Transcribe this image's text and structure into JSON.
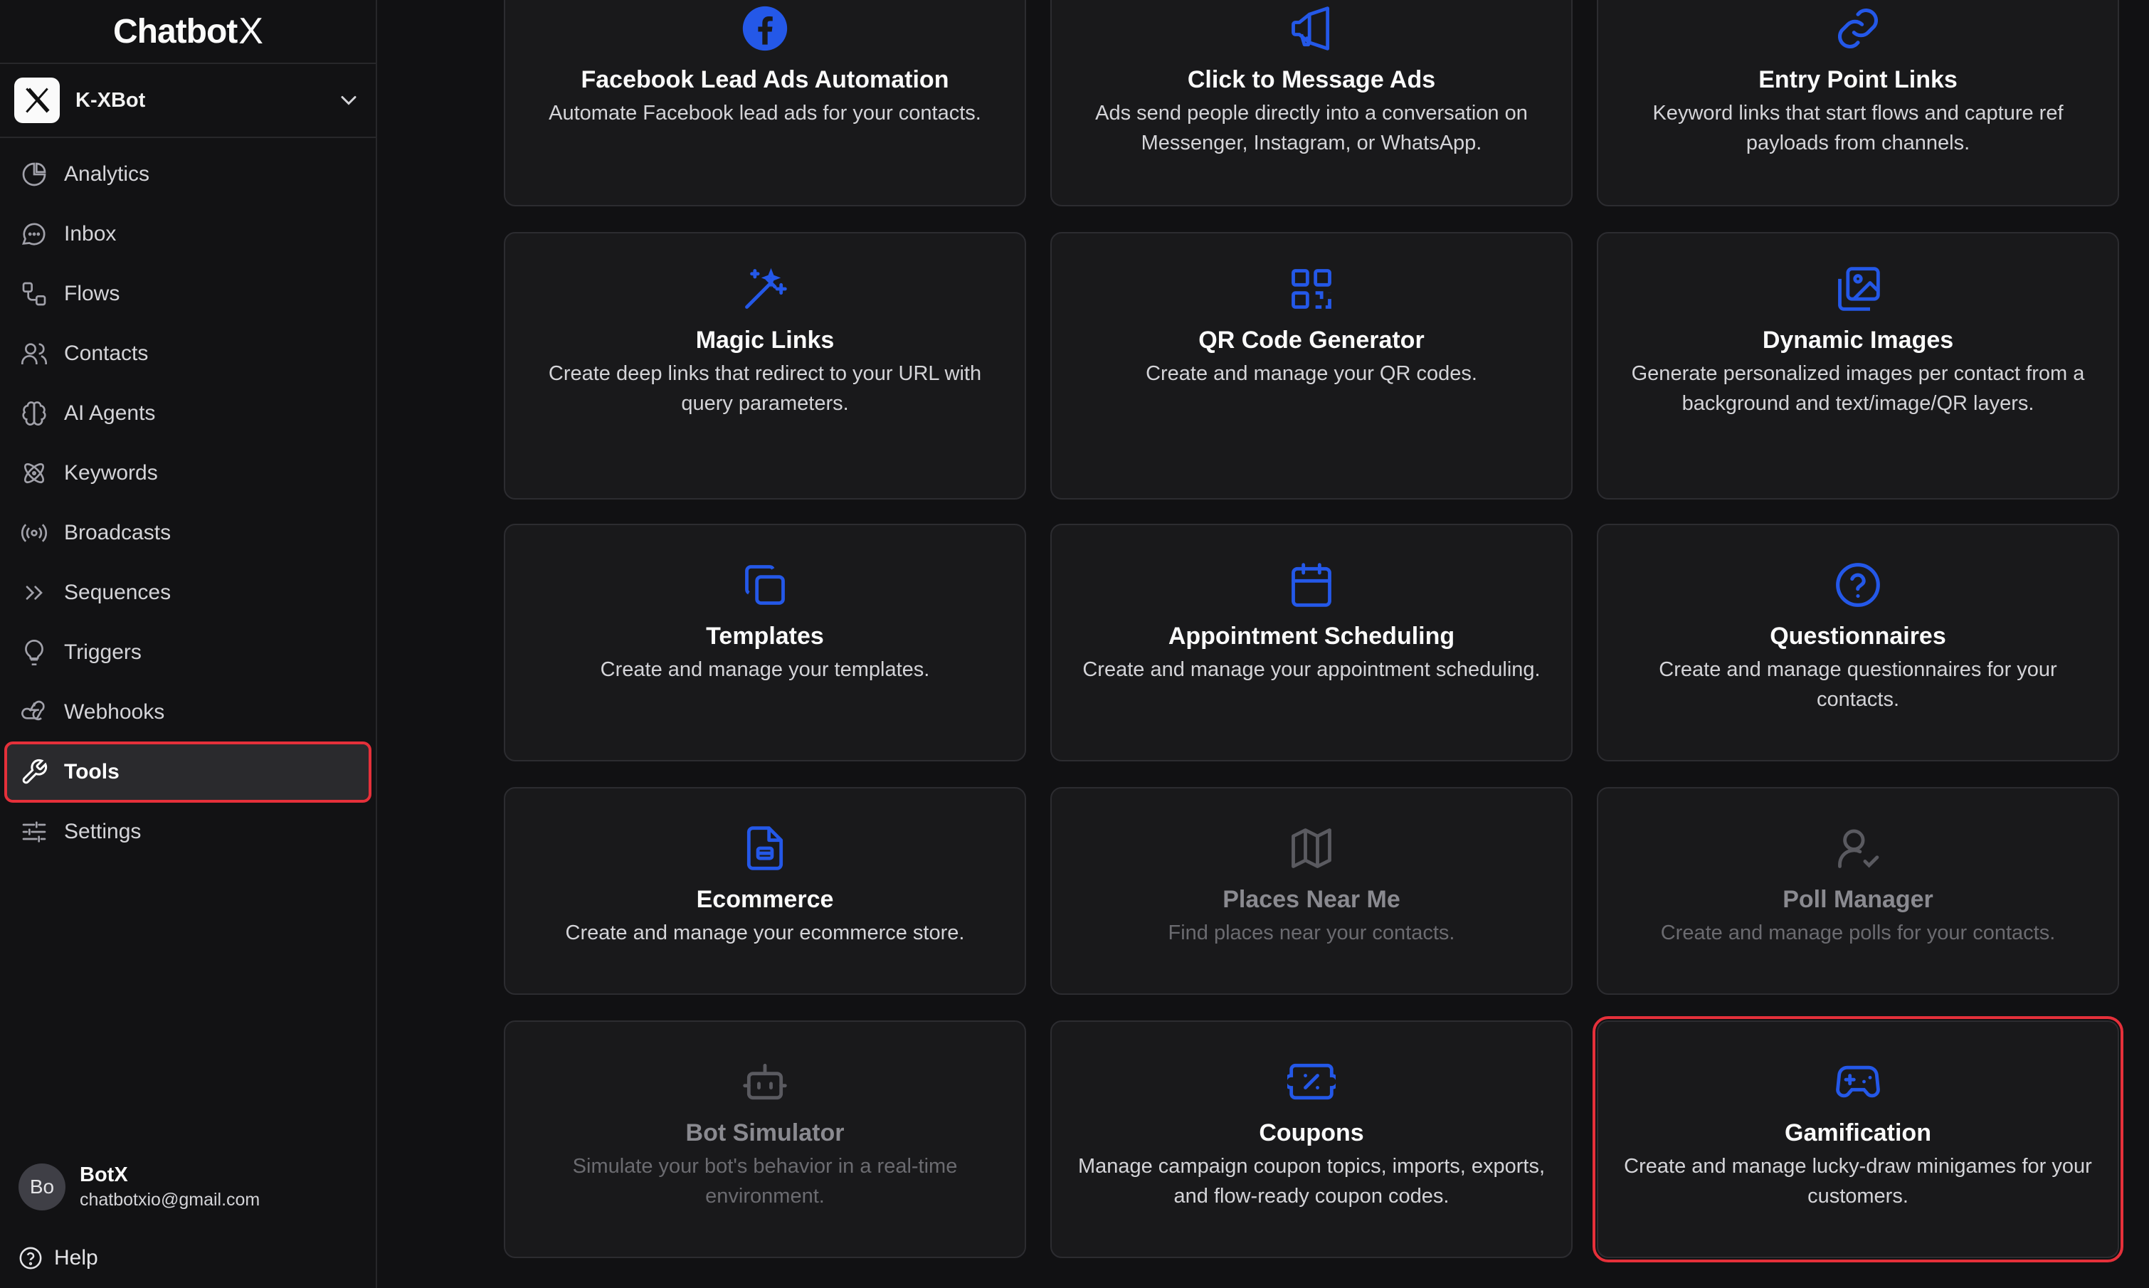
{
  "brand": {
    "name": "Chatbot",
    "mark": "X"
  },
  "bot_selector": {
    "name": "K-XBot"
  },
  "nav": [
    {
      "key": "analytics",
      "label": "Analytics",
      "icon": "pie-chart-icon"
    },
    {
      "key": "inbox",
      "label": "Inbox",
      "icon": "chat-bubble-icon"
    },
    {
      "key": "flows",
      "label": "Flows",
      "icon": "flow-icon"
    },
    {
      "key": "contacts",
      "label": "Contacts",
      "icon": "users-icon"
    },
    {
      "key": "ai-agents",
      "label": "AI Agents",
      "icon": "brain-icon"
    },
    {
      "key": "keywords",
      "label": "Keywords",
      "icon": "atom-icon"
    },
    {
      "key": "broadcasts",
      "label": "Broadcasts",
      "icon": "broadcast-icon"
    },
    {
      "key": "sequences",
      "label": "Sequences",
      "icon": "double-chevron-icon"
    },
    {
      "key": "triggers",
      "label": "Triggers",
      "icon": "lightbulb-icon"
    },
    {
      "key": "webhooks",
      "label": "Webhooks",
      "icon": "webhook-icon"
    },
    {
      "key": "tools",
      "label": "Tools",
      "icon": "wrench-icon",
      "active": true
    },
    {
      "key": "settings",
      "label": "Settings",
      "icon": "sliders-icon"
    }
  ],
  "user": {
    "initials": "Bo",
    "name": "BotX",
    "email": "chatbotxio@gmail.com"
  },
  "help": {
    "label": "Help"
  },
  "tools": [
    {
      "title": "Facebook Lead Ads Automation",
      "desc": "Automate Facebook lead ads for your contacts.",
      "icon": "facebook-icon"
    },
    {
      "title": "Click to Message Ads",
      "desc": "Ads send people directly into a conversation on Messenger, Instagram, or WhatsApp.",
      "icon": "megaphone-icon"
    },
    {
      "title": "Entry Point Links",
      "desc": "Keyword links that start flows and capture ref payloads from channels.",
      "icon": "link-icon"
    },
    {
      "title": "Magic Links",
      "desc": "Create deep links that redirect to your URL with query parameters.",
      "icon": "magic-wand-icon"
    },
    {
      "title": "QR Code Generator",
      "desc": "Create and manage your QR codes.",
      "icon": "qr-code-icon"
    },
    {
      "title": "Dynamic Images",
      "desc": "Generate personalized images per contact from a background and text/image/QR layers.",
      "icon": "images-icon"
    },
    {
      "title": "Templates",
      "desc": "Create and manage your templates.",
      "icon": "copy-icon"
    },
    {
      "title": "Appointment Scheduling",
      "desc": "Create and manage your appointment scheduling.",
      "icon": "calendar-icon"
    },
    {
      "title": "Questionnaires",
      "desc": "Create and manage questionnaires for your contacts.",
      "icon": "question-circle-icon"
    },
    {
      "title": "Ecommerce",
      "desc": "Create and manage your ecommerce store.",
      "icon": "store-file-icon"
    },
    {
      "title": "Places Near Me",
      "desc": "Find places near your contacts.",
      "icon": "map-icon",
      "disabled": true
    },
    {
      "title": "Poll Manager",
      "desc": "Create and manage polls for your contacts.",
      "icon": "user-check-icon",
      "disabled": true
    },
    {
      "title": "Bot Simulator",
      "desc": "Simulate your bot's behavior in a real-time environment.",
      "icon": "bot-icon",
      "disabled": true
    },
    {
      "title": "Coupons",
      "desc": "Manage campaign coupon topics, imports, exports, and flow-ready coupon codes.",
      "icon": "ticket-percent-icon"
    },
    {
      "title": "Gamification",
      "desc": "Create and manage lucky-draw minigames for your customers.",
      "icon": "gamepad-icon",
      "highlighted": true
    }
  ]
}
